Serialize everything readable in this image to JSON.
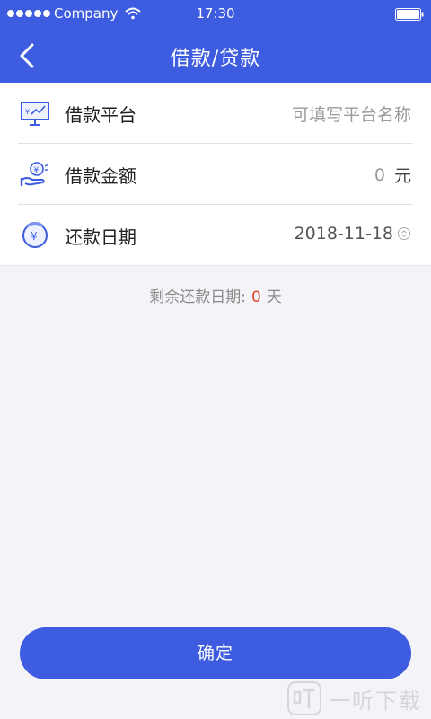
{
  "status_bar": {
    "carrier": "Company",
    "time": "17:30"
  },
  "nav": {
    "title": "借款/贷款"
  },
  "form": {
    "platform": {
      "label": "借款平台",
      "placeholder": "可填写平台名称"
    },
    "amount": {
      "label": "借款金额",
      "value": "0",
      "unit": "元"
    },
    "repay_date": {
      "label": "还款日期",
      "value": "2018-11-18"
    }
  },
  "remaining": {
    "prefix": "剩余还款日期:",
    "days": "0",
    "suffix": "天"
  },
  "confirm": {
    "label": "确定"
  },
  "watermark": {
    "text": "一听下载"
  },
  "colors": {
    "primary": "#3d5ce0",
    "accent_red": "#e2442f",
    "background": "#f4f4f8"
  },
  "icons": {
    "platform": "monitor-chart-icon",
    "amount": "hand-coin-icon",
    "repay_date": "yuan-clock-icon"
  }
}
